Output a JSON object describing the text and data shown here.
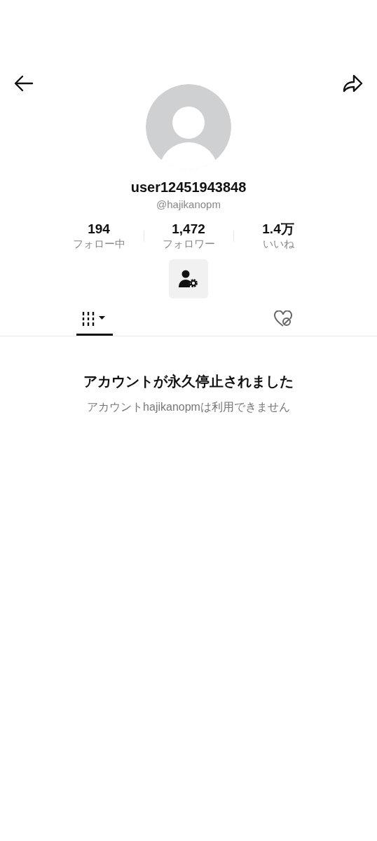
{
  "profile": {
    "username": "user12451943848",
    "handle": "@hajikanopm"
  },
  "stats": [
    {
      "value": "194",
      "label": "フォロー中"
    },
    {
      "value": "1,472",
      "label": "フォロワー"
    },
    {
      "value": "1.4万",
      "label": "いいね"
    }
  ],
  "tabs": [
    {
      "kind": "videos",
      "selected": true
    },
    {
      "kind": "liked",
      "selected": false
    }
  ],
  "notice": {
    "title": "アカウントが永久停止されました",
    "message": "アカウントhajikanopmは利用できません"
  }
}
